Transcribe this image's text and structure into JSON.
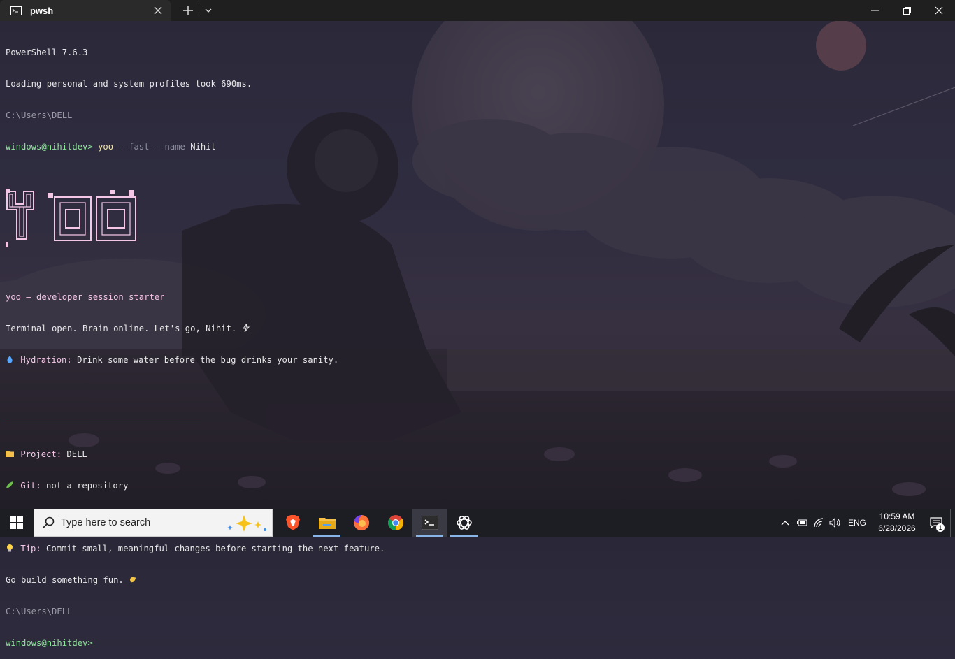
{
  "window": {
    "tab_title": "pwsh",
    "tab_icon": "terminal-icon",
    "controls": [
      "minimize-icon",
      "restore-icon",
      "close-icon"
    ]
  },
  "terminal": {
    "line1": "PowerShell 7.6.3",
    "line2": "Loading personal and system profiles took 690ms.",
    "cwd1": "C:\\Users\\DELL",
    "prompt_user": "windows@nihitdev>",
    "cmd_name": "yoo",
    "cmd_flag1": "--fast",
    "cmd_flag2": "--name",
    "cmd_arg": "Nihit",
    "banner_text": "YOO",
    "tagline": "yoo — developer session starter",
    "greeting": "Terminal open. Brain online. Let's go, Nihit.",
    "hydration_label": "Hydration:",
    "hydration_text": "Drink some water before the bug drinks your sanity.",
    "project_label": "Project:",
    "project_value": "DELL",
    "git_label": "Git:",
    "git_value": "not a repository",
    "tip_label": "Tip:",
    "tip_text": "Commit small, meaningful changes before starting the next feature.",
    "closing": "Go build something fun.",
    "cwd2": "C:\\Users\\DELL",
    "prompt2": "windows@nihitdev>",
    "colors": {
      "prompt": "#8fe39a",
      "banner": "#f4c6e6",
      "label": "#f4c6e6"
    }
  },
  "taskbar": {
    "search_placeholder": "Type here to search",
    "apps": [
      "brave-icon",
      "file-explorer-icon",
      "firefox-icon",
      "chrome-icon",
      "terminal-icon",
      "chatgpt-icon"
    ],
    "active_app": "terminal-icon",
    "language": "ENG",
    "time": "10:59 AM",
    "date": "6/28/2026",
    "notification_count": "1"
  }
}
